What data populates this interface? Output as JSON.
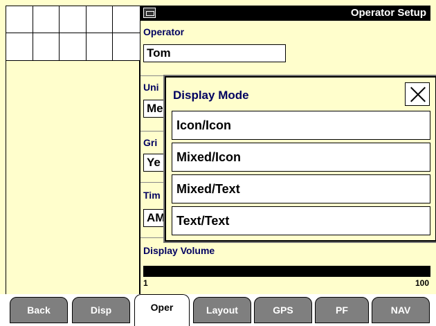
{
  "window": {
    "title": "Operator Setup",
    "title_icon": "display-icon"
  },
  "operator": {
    "label": "Operator",
    "value": "Tom"
  },
  "units": {
    "label": "Uni",
    "value": "Me"
  },
  "grid": {
    "label": "Gri",
    "value": "Ye"
  },
  "time": {
    "label": "Tim",
    "value": "AM"
  },
  "display_volume": {
    "label": "Display Volume",
    "min": "1",
    "max": "100",
    "level_percent": 100
  },
  "modal": {
    "title": "Display Mode",
    "close_icon": "close-icon",
    "options": [
      "Icon/Icon",
      "Mixed/Icon",
      "Mixed/Text",
      "Text/Text"
    ]
  },
  "tabs": [
    "Back",
    "Disp",
    "Oper",
    "Layout",
    "GPS",
    "PF",
    "NAV"
  ],
  "active_tab": "Oper",
  "colors": {
    "background": "#fffecc",
    "label_text": "#000060",
    "tab_inactive": "#7f7f7f",
    "title_bar": "#000000"
  }
}
